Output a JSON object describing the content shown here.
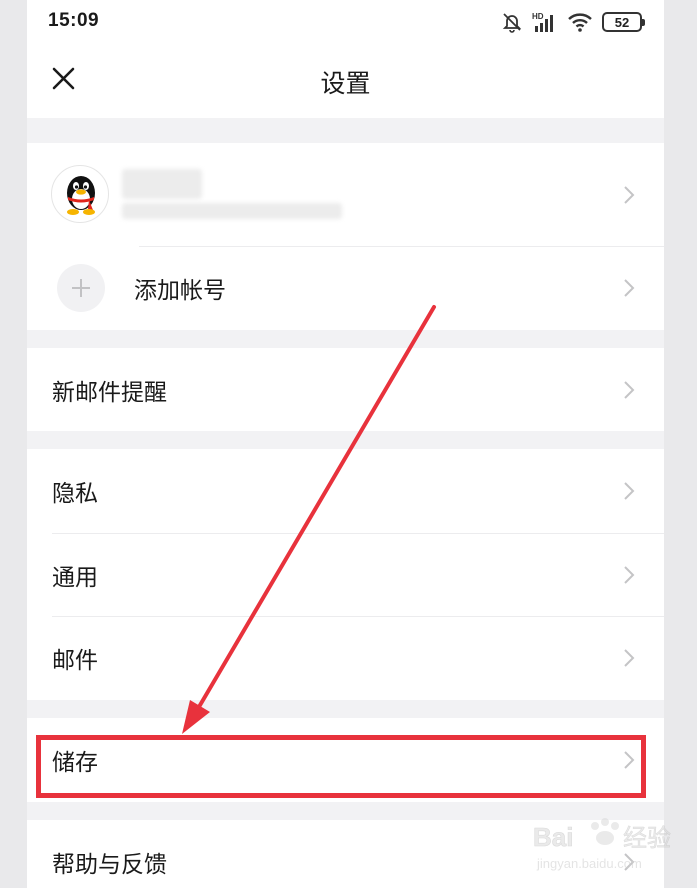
{
  "status_bar": {
    "time": "15:09",
    "network_label": "HD",
    "battery_level": "52"
  },
  "nav": {
    "title": "设置",
    "close_icon": "close-icon"
  },
  "account": {
    "add_account_label": "添加帐号"
  },
  "menu": {
    "new_mail_alert": "新邮件提醒",
    "privacy": "隐私",
    "general": "通用",
    "mail": "邮件",
    "storage": "储存",
    "help_feedback": "帮助与反馈"
  },
  "watermark": {
    "brand": "Bai",
    "brand_cn": "经验",
    "url": "jingyan.baidu.com"
  },
  "colors": {
    "highlight": "#e8323c",
    "background": "#f2f2f4",
    "card": "#ffffff",
    "chevron": "#c4c4c6"
  }
}
